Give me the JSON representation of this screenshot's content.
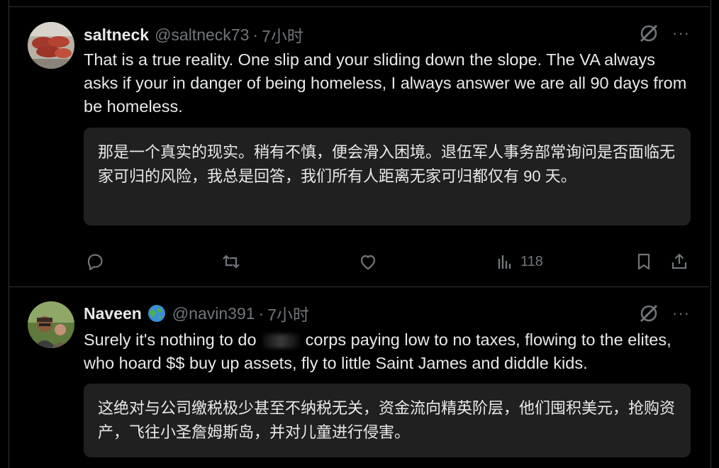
{
  "posts": [
    {
      "name": "saltneck",
      "handle": "@saltneck73",
      "dot": "·",
      "time": "7小时",
      "text": "That is a true reality. One slip and your sliding down the slope. The VA always asks if your in danger of being homeless, I always answer we are all 90 days from be homeless.",
      "translation": "那是一个真实的现实。稍有不慎，便会滑入困境。退伍军人事务部常询问是否面临无家可归的风险，我总是回答，我们所有人距离无家可归都仅有 90 天。",
      "views": "118",
      "more": "···"
    },
    {
      "name": "Naveen",
      "handle": "@navin391",
      "dot": "·",
      "time": "7小时",
      "text_before": "Surely it's nothing to do",
      "text_after": "corps paying low to no taxes, flowing to the elites, who hoard $$ buy up assets, fly to little Saint James and diddle kids.",
      "translation": "这绝对与公司缴税极少甚至不纳税无关，资金流向精英阶层，他们囤积美元，抢购资产，飞往小圣詹姆斯岛，并对儿童进行侵害。",
      "more": "···"
    }
  ],
  "icons": {
    "grok": "grok-icon",
    "reply": "reply-icon",
    "repost": "repost-icon",
    "like": "like-icon",
    "views": "views-icon",
    "bookmark": "bookmark-icon",
    "share": "share-icon",
    "globe": "globe-icon"
  },
  "colors": {
    "background": "#000000",
    "text": "#e7e9ea",
    "muted": "#71767b",
    "translation_bg": "#202020",
    "border": "#2f3336"
  }
}
